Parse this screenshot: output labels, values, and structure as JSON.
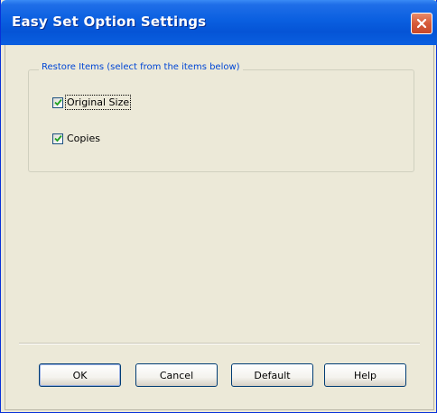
{
  "window": {
    "title": "Easy Set Option Settings",
    "accent_color": "#0a5fe0",
    "close_icon": "close-icon"
  },
  "group": {
    "legend": "Restore Items (select from the items below)",
    "items": [
      {
        "label": "Original Size",
        "checked": true
      },
      {
        "label": "Copies",
        "checked": true
      }
    ]
  },
  "buttons": {
    "ok": "OK",
    "cancel": "Cancel",
    "default": "Default",
    "help": "Help"
  }
}
